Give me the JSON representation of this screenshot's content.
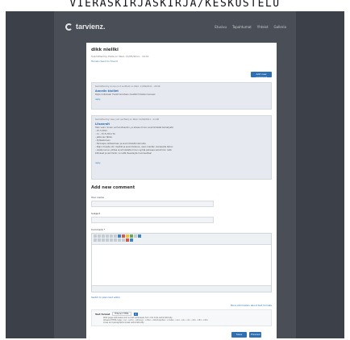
{
  "caption": "VIERASKIRJASKIRJA/KESKUSTELU",
  "site": {
    "logo_text": "tarvienz.",
    "nav": [
      "Etusivu",
      "Tapahtumat",
      "Yhteist",
      "Galleria"
    ]
  },
  "post": {
    "title": "dikk niellki",
    "meta": "Submitted by Pieta on Wed, 11/05/2011 - 19:41",
    "links": "Tulostu  Send to friend"
  },
  "add_comment_button": "Add new comment",
  "comments": [
    {
      "meta": "Submitted by Annie (not verified) on Wed, 11/09/2011 - 20:06",
      "subject": "Annelin kloillet",
      "lines": [
        "Paljon kiitoksia! Tiedot tarvitaan meidät ihmisten kanssa!"
      ],
      "reply": "reply"
    },
    {
      "meta": "Submitted by Liisa (not verified) on Wed, 11/09/2011 - 21:08",
      "subject": "Liisanrait",
      "lines": [
        "Heki valni rinnan vel tarvitsenkin, ja alassa minun ensimmäistä kemetystä",
        "- 15.3.2011",
        "- 11 - 15.5.2011 TA",
        "- Jatkuvan tähän",
        "- Pyhtestoinen",
        "- Tarkuspa valitsemaan ja ensimmäistä kierrosta",
        "- Paljon tuesta olin meidät ja ensimmäinen, vaan meidän vieraisella tahan",
        "- Lisäksi sinun johtaa sinut kielletä minun syödä pahessa selvimmin ristä",
        "Kiitokset ja lemmikki, voi että Tuesdayta huomauttaa!"
      ],
      "reply": "reply"
    }
  ],
  "form": {
    "heading": "Add new comment",
    "name_label": "Your name",
    "subject_label": "Subject",
    "comment_label": "Comment *",
    "switch_editor": "Switch to plain text editor",
    "more_info": "More information about text formats",
    "format_label": "Text format",
    "format_value": "Filtered HTML",
    "tips": [
      "Web page addresses and e-mail addresses turn into links automatically.",
      "Allowed HTML tags: <a> <em> <strong> <cite> <blockquote> <code> <ul> <ol> <li> <dl> <dt> <dd>",
      "Lines and paragraphs break automatically."
    ],
    "save_label": "Save",
    "preview_label": "Preview"
  }
}
